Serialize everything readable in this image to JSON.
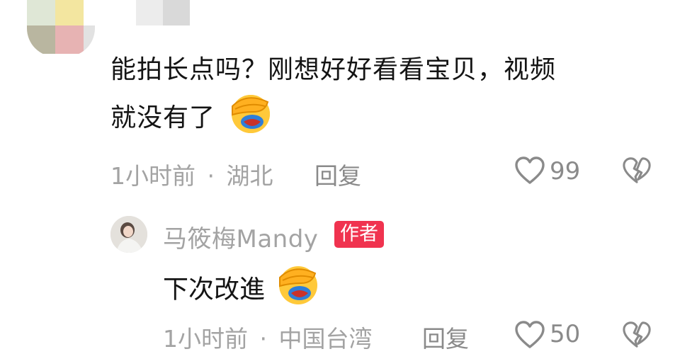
{
  "top_comment": {
    "text_line1": "能拍长点吗？刚想好好看看宝贝，视频",
    "text_line2": "就没有了",
    "emoji": "facepalm-laughing-emoji",
    "time": "1小时前",
    "separator": "·",
    "location": "湖北",
    "reply_label": "回复",
    "like_count": "99"
  },
  "reply": {
    "username": "马筱梅Mandy",
    "badge": "作者",
    "text": "下次改進",
    "emoji": "facepalm-laughing-emoji",
    "time": "1小时前",
    "separator": "·",
    "location": "中国台湾",
    "reply_label": "回复",
    "like_count": "50"
  },
  "colors": {
    "badge": "#f0334f",
    "meta_text": "#a3a3a3",
    "body_text": "#141414"
  }
}
